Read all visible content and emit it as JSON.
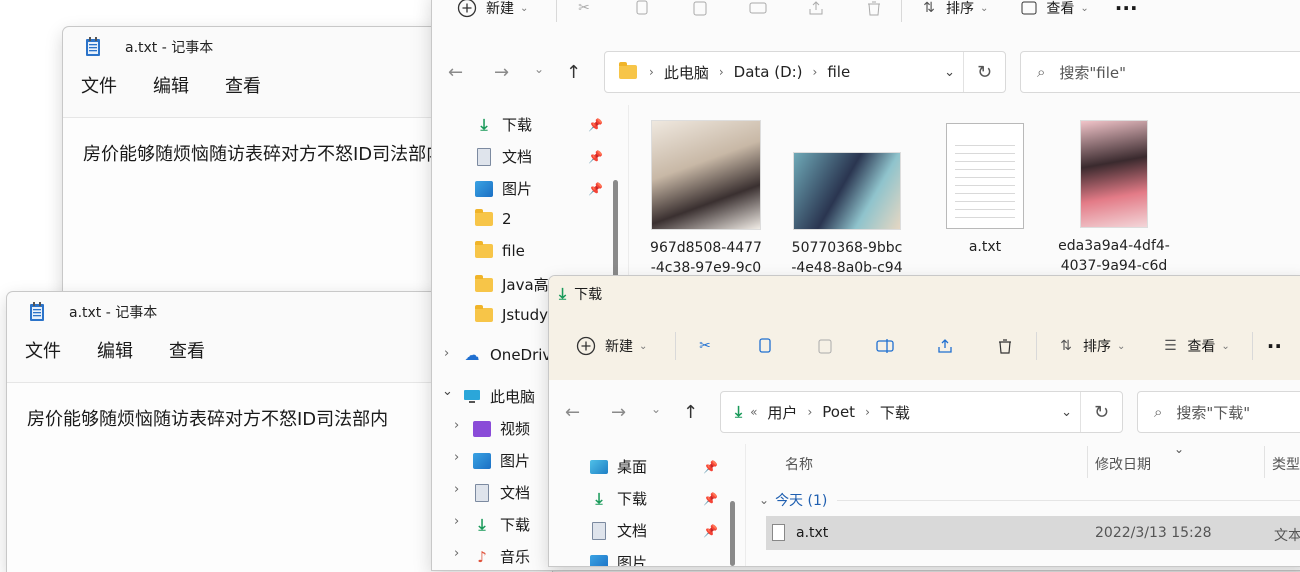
{
  "notepad1": {
    "title": "a.txt - 记事本",
    "menu": [
      "文件",
      "编辑",
      "查看"
    ],
    "content": "房价能够随烦恼随访表碎对方不怒ID司法部内"
  },
  "notepad2": {
    "title": "a.txt - 记事本",
    "menu": [
      "文件",
      "编辑",
      "查看"
    ],
    "content": "房价能够随烦恼随访表碎对方不怒ID司法部内"
  },
  "explorer_file": {
    "toolbar": {
      "new_label": "新建",
      "sort_label": "排序",
      "view_label": "查看",
      "more": "···"
    },
    "breadcrumb": [
      "此电脑",
      "Data (D:)",
      "file"
    ],
    "search_placeholder": "搜索\"file\"",
    "sidebar": [
      {
        "label": "下载",
        "icon": "download-icon",
        "pinned": true
      },
      {
        "label": "文档",
        "icon": "document-icon",
        "pinned": true
      },
      {
        "label": "图片",
        "icon": "pictures-icon",
        "pinned": true
      },
      {
        "label": "2",
        "icon": "folder-icon",
        "pinned": false
      },
      {
        "label": "file",
        "icon": "folder-icon",
        "pinned": false
      },
      {
        "label": "Java高级",
        "icon": "folder-icon",
        "pinned": false
      },
      {
        "label": "Jstudy",
        "icon": "folder-icon",
        "pinned": false
      },
      {
        "label": "OneDrive",
        "icon": "onedrive-icon",
        "pinned": false
      },
      {
        "label": "此电脑",
        "icon": "this-pc-icon",
        "pinned": false
      },
      {
        "label": "视频",
        "icon": "videos-icon",
        "pinned": false
      },
      {
        "label": "图片",
        "icon": "pictures-icon",
        "pinned": false
      },
      {
        "label": "文档",
        "icon": "document-icon",
        "pinned": false
      },
      {
        "label": "下载",
        "icon": "download-icon",
        "pinned": false
      },
      {
        "label": "音乐",
        "icon": "music-icon",
        "pinned": false
      }
    ],
    "files": [
      {
        "line1": "967d8508-4477",
        "line2": "-4c38-97e9-9c0"
      },
      {
        "line1": "50770368-9bbc",
        "line2": "-4e48-8a0b-c94"
      },
      {
        "line1": "a.txt",
        "line2": ""
      },
      {
        "line1": "eda3a9a4-4df4-",
        "line2": "4037-9a94-c6d"
      }
    ]
  },
  "explorer_dl": {
    "title": "下载",
    "toolbar": {
      "new_label": "新建",
      "sort_label": "排序",
      "view_label": "查看",
      "more": "··"
    },
    "breadcrumb": [
      "用户",
      "Poet",
      "下载"
    ],
    "breadcrumb_prefix": "«",
    "search_placeholder": "搜索\"下载\"",
    "sidebar": [
      {
        "label": "桌面",
        "icon": "desktop-icon"
      },
      {
        "label": "下载",
        "icon": "download-icon"
      },
      {
        "label": "文档",
        "icon": "document-icon"
      },
      {
        "label": "图片",
        "icon": "pictures-icon"
      }
    ],
    "columns": [
      "名称",
      "修改日期",
      "类型"
    ],
    "group": "今天 (1)",
    "rows": [
      {
        "name": "a.txt",
        "date": "2022/3/13 15:28",
        "type": "文本"
      }
    ]
  }
}
